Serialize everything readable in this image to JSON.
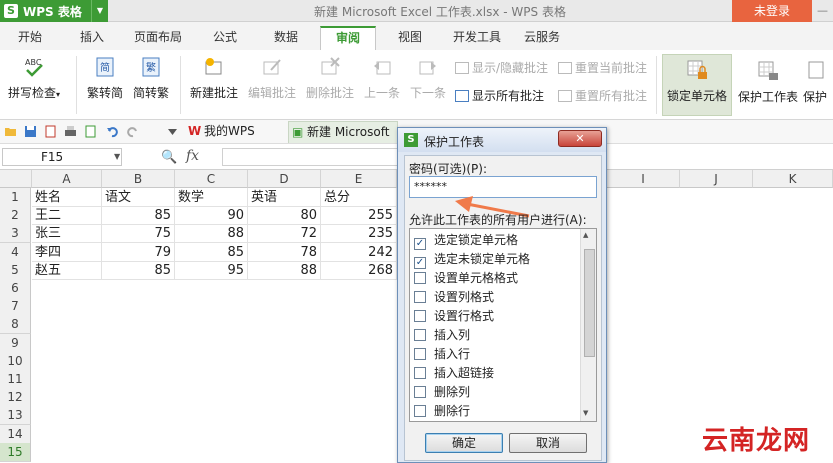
{
  "app": {
    "name": "WPS 表格",
    "doc_title": "新建 Microsoft Excel 工作表.xlsx - WPS 表格",
    "login_label": "未登录"
  },
  "tabs": [
    "开始",
    "插入",
    "页面布局",
    "公式",
    "数据",
    "审阅",
    "视图",
    "开发工具",
    "云服务"
  ],
  "active_tab": "审阅",
  "ribbon": {
    "spellcheck": "拼写检查",
    "trad_to_simp": "繁转简",
    "simp_to_trad": "简转繁",
    "new_comment": "新建批注",
    "edit_comment": "编辑批注",
    "delete_comment": "删除批注",
    "previous": "上一条",
    "next": "下一条",
    "show_hide_comment": "显示/隐藏批注",
    "show_all_comments": "显示所有批注",
    "reset_current_comment": "重置当前批注",
    "reset_all_comments": "重置所有批注",
    "lock_cell": "锁定单元格",
    "protect_sheet": "保护工作表",
    "protect_more": "保护"
  },
  "doc_tabs": {
    "my_wps": "我的WPS",
    "file": "新建 Microsoft"
  },
  "formula_bar": {
    "name_box": "F15",
    "fx": "fx"
  },
  "columns": [
    "A",
    "B",
    "C",
    "D",
    "E",
    "I",
    "J",
    "K"
  ],
  "rows": [
    "1",
    "2",
    "3",
    "4",
    "5",
    "6",
    "7",
    "8",
    "9",
    "10",
    "11",
    "12",
    "13",
    "14",
    "15"
  ],
  "table": {
    "headers": [
      "姓名",
      "语文",
      "数学",
      "英语",
      "总分"
    ],
    "rows": [
      [
        "王二",
        "85",
        "90",
        "80",
        "255"
      ],
      [
        "张三",
        "75",
        "88",
        "72",
        "235"
      ],
      [
        "李四",
        "79",
        "85",
        "78",
        "242"
      ],
      [
        "赵五",
        "85",
        "95",
        "88",
        "268"
      ]
    ]
  },
  "dialog": {
    "title": "保护工作表",
    "password_label": "密码(可选)(P):",
    "password_value": "******",
    "allow_label": "允许此工作表的所有用户进行(A):",
    "options": [
      {
        "label": "选定锁定单元格",
        "checked": true
      },
      {
        "label": "选定未锁定单元格",
        "checked": true
      },
      {
        "label": "设置单元格格式",
        "checked": false
      },
      {
        "label": "设置列格式",
        "checked": false
      },
      {
        "label": "设置行格式",
        "checked": false
      },
      {
        "label": "插入列",
        "checked": false
      },
      {
        "label": "插入行",
        "checked": false
      },
      {
        "label": "插入超链接",
        "checked": false
      },
      {
        "label": "删除列",
        "checked": false
      },
      {
        "label": "删除行",
        "checked": false
      }
    ],
    "ok_label": "确定",
    "cancel_label": "取消"
  },
  "watermark": "云南龙网",
  "colors": {
    "brand_green": "#3d9b35",
    "login_orange": "#e8643f",
    "arrow": "#f07a4a"
  }
}
